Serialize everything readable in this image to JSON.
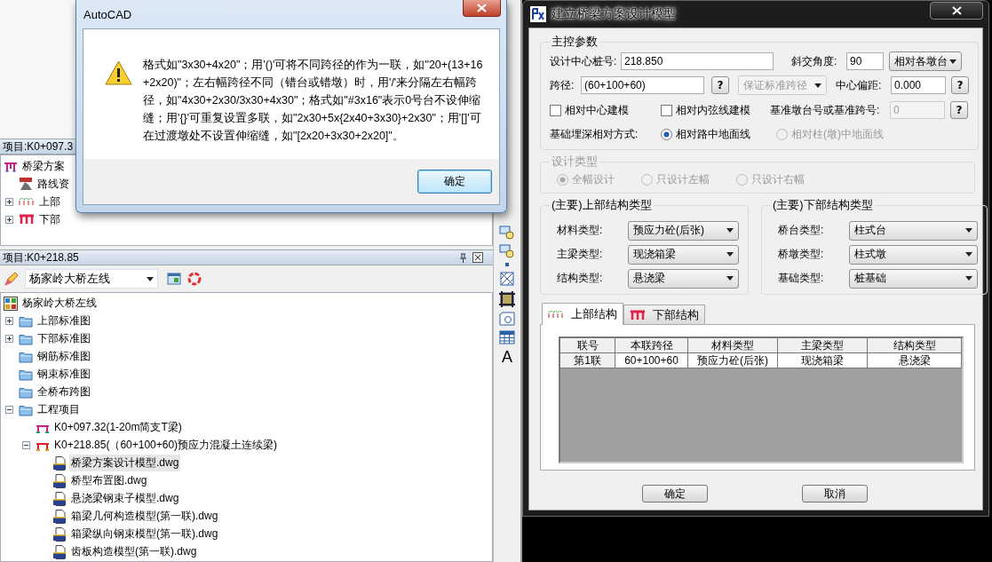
{
  "message_box": {
    "title": "AutoCAD",
    "message": "格式如\"3x30+4x20\"；用'()'可将不同跨径的作为一联，如\"20+(13+16+2x20)\"；左右幅跨径不同（错台或错墩）时，用'/'来分隔左右幅跨径，如\"4x30+2x30/3x30+4x30\"；格式如\"#3x16\"表示0号台不设伸缩缝；用'{}'可重复设置多联，如\"2x30+5x{2x40+3x30}+2x30\"；用'[]'可在过渡墩处不设置伸缩缝，如\"[2x20+3x30+2x20]\"。",
    "ok_button": "确定"
  },
  "left_palette": {
    "top_panel": {
      "header": "项目:K0+097.3",
      "tree": [
        {
          "label": "桥梁方案",
          "kind": "bridge-plan",
          "selected": false,
          "children": [
            {
              "label": "路线资",
              "kind": "route",
              "selected": false
            },
            {
              "label": "上部",
              "kind": "superstructure",
              "expanded": false,
              "selected": false
            },
            {
              "label": "下部",
              "kind": "substructure",
              "expanded": false,
              "selected": false
            }
          ]
        }
      ]
    },
    "bottom_panel": {
      "header": "项目:K0+218.85",
      "combo": "杨家岭大桥左线",
      "tree": [
        {
          "label": "杨家岭大桥左线",
          "kind": "project",
          "selected": false,
          "children": [
            {
              "label": "上部标准图",
              "kind": "folder",
              "expanded": false,
              "selected": false
            },
            {
              "label": "下部标准图",
              "kind": "folder",
              "expanded": false,
              "selected": false
            },
            {
              "label": "钢筋标准图",
              "kind": "folder",
              "selected": false
            },
            {
              "label": "钢束标准图",
              "kind": "folder",
              "selected": false
            },
            {
              "label": "全桥布跨图",
              "kind": "folder",
              "selected": false
            },
            {
              "label": "工程项目",
              "kind": "folder",
              "expanded": true,
              "selected": false,
              "children": [
                {
                  "label": "K0+097.32(1-20m简支T梁)",
                  "kind": "simple-bridge",
                  "selected": false
                },
                {
                  "label": "K0+218.85(（60+100+60)预应力混凝土连续梁)",
                  "kind": "continuous-bridge",
                  "expanded": true,
                  "selected": false,
                  "children": [
                    {
                      "label": "桥梁方案设计模型.dwg",
                      "kind": "dwg",
                      "selected": true
                    },
                    {
                      "label": "桥型布置图.dwg",
                      "kind": "dwg",
                      "selected": false
                    },
                    {
                      "label": "悬浇梁钢束子模型.dwg",
                      "kind": "dwg",
                      "selected": false
                    },
                    {
                      "label": "箱梁几何构造模型(第一联).dwg",
                      "kind": "dwg",
                      "selected": false
                    },
                    {
                      "label": "箱梁纵向钢束模型(第一联).dwg",
                      "kind": "dwg",
                      "selected": false
                    },
                    {
                      "label": "齿板构造模型(第一联).dwg",
                      "kind": "dwg",
                      "selected": false
                    }
                  ]
                }
              ]
            }
          ]
        }
      ]
    }
  },
  "toolbar_strip": {
    "text_tool": "A"
  },
  "dialog": {
    "title": "建立桥梁方案设计模型",
    "main_params": {
      "legend": "主控参数",
      "station_label": "设计中心桩号:",
      "station_value": "218.850",
      "skew_label": "斜交角度:",
      "skew_value": "90",
      "skew_mode": "相对各墩台",
      "span_label": "跨径:",
      "span_value": "(60+100+60)",
      "span_help": "?",
      "span_mode": {
        "value": "保证标准跨径",
        "disabled": true
      },
      "offset_label": "中心偏距:",
      "offset_value": "0.000",
      "offset_help": "?",
      "checkboxes": [
        {
          "label": "相对中心建模",
          "checked": false
        },
        {
          "label": "相对内弦线建模",
          "checked": false
        }
      ],
      "ref_label": "基准墩台号或基准跨号:",
      "ref_value": {
        "value": "0",
        "disabled": true
      },
      "ref_help": "?",
      "depth_label": "基础埋深相对方式:",
      "depth_options": [
        {
          "label": "相对路中地面线",
          "selected": true,
          "disabled": false
        },
        {
          "label": "相对柱(墩)中地面线",
          "selected": false,
          "disabled": true
        }
      ]
    },
    "design_type": {
      "legend": "设计类型",
      "disabled": true,
      "options": [
        {
          "label": "全幅设计",
          "selected": true
        },
        {
          "label": "只设计左幅",
          "selected": false
        },
        {
          "label": "只设计右幅",
          "selected": false
        }
      ]
    },
    "super_group": {
      "legend": "(主要)上部结构类型",
      "fields": [
        {
          "label": "材料类型:",
          "value": "预应力砼(后张)"
        },
        {
          "label": "主梁类型:",
          "value": "现浇箱梁"
        },
        {
          "label": "结构类型:",
          "value": "悬浇梁"
        }
      ]
    },
    "sub_group": {
      "legend": "(主要)下部结构类型",
      "fields": [
        {
          "label": "桥台类型:",
          "value": "柱式台"
        },
        {
          "label": "桥墩类型:",
          "value": "柱式墩"
        },
        {
          "label": "基础类型:",
          "value": "桩基础"
        }
      ]
    },
    "tabs": [
      {
        "label": "上部结构",
        "kind": "super",
        "selected": true
      },
      {
        "label": "下部结构",
        "kind": "sub",
        "selected": false
      }
    ],
    "table": {
      "columns": [
        "联号",
        "本联跨径",
        "材料类型",
        "主梁类型",
        "结构类型"
      ],
      "rows": [
        [
          "第1联",
          "60+100+60",
          "预应力砼(后张)",
          "现浇箱梁",
          "悬浇梁"
        ]
      ]
    },
    "buttons": [
      "确定",
      "取消"
    ]
  }
}
